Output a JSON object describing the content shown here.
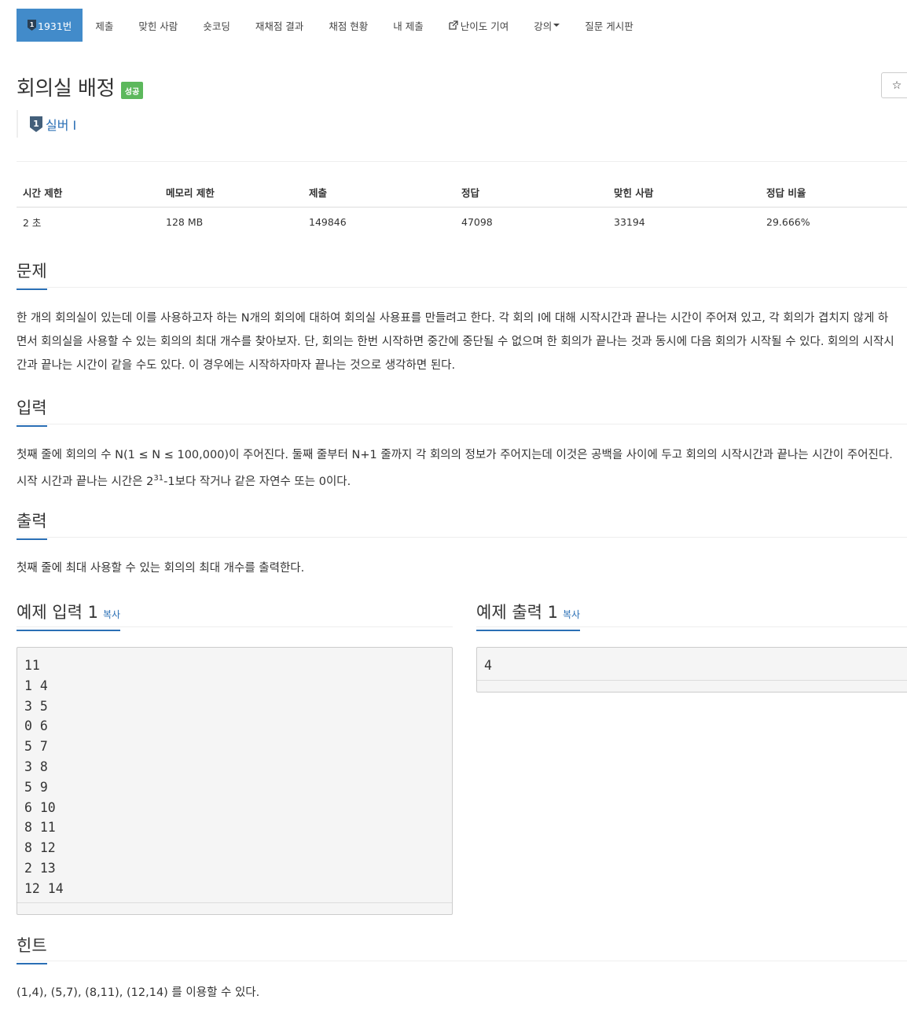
{
  "nav": {
    "problem_number": "1931번",
    "submit": "제출",
    "solvers": "맞힌 사람",
    "short_coding": "숏코딩",
    "rejudge": "재채점 결과",
    "status": "채점 현황",
    "my_submissions": "내 제출",
    "difficulty": "난이도 기여",
    "lecture": "강의",
    "qna": "질문 게시판"
  },
  "problem": {
    "title": "회의실 배정",
    "status_label": "성공",
    "star": "☆",
    "tier": "실버 I"
  },
  "info_table": {
    "headers": [
      "시간 제한",
      "메모리 제한",
      "제출",
      "정답",
      "맞힌 사람",
      "정답 비율"
    ],
    "values": [
      "2 초",
      "128 MB",
      "149846",
      "47098",
      "33194",
      "29.666%"
    ]
  },
  "sections": {
    "description_title": "문제",
    "description_lines": [
      "한 개의 회의실이 있는데 이를 사용하고자 하는 N개의 회의에 대하여 회의실 사용표를 만들려고 한다. 각 회의 I에 대해 시작시간과 끝나는 시간이 주어져 있고, 각 회의가 겹치지 않게 하",
      "면서 회의실을 사용할 수 있는 회의의 최대 개수를 찾아보자. 단, 회의는 한번 시작하면 중간에 중단될 수 없으며 한 회의가 끝나는 것과 동시에 다음 회의가 시작될 수 있다. 회의의 시작시",
      "간과 끝나는 시간이 같을 수도 있다. 이 경우에는 시작하자마자 끝나는 것으로 생각하면 된다."
    ],
    "input_title": "입력",
    "input_line1": "첫째 줄에 회의의 수 N(1 ≤ N ≤ 100,000)이 주어진다. 둘째 줄부터 N+1 줄까지 각 회의의 정보가 주어지는데 이것은 공백을 사이에 두고 회의의 시작시간과 끝나는 시간이 주어진다.",
    "input_line2_pre": "시작 시간과 끝나는 시간은 2",
    "input_line2_sup": "31",
    "input_line2_post": "-1보다 작거나 같은 자연수 또는 0이다.",
    "output_title": "출력",
    "output_text": "첫째 줄에 최대 사용할 수 있는 회의의 최대 개수를 출력한다.",
    "sample_input_title": "예제 입력 1",
    "sample_output_title": "예제 출력 1",
    "copy": "복사",
    "sample_input": "11\n1 4\n3 5\n0 6\n5 7\n3 8\n5 9\n6 10\n8 11\n8 12\n2 13\n12 14",
    "sample_output": "4",
    "hint_title": "힌트",
    "hint_text": "(1,4), (5,7), (8,11), (12,14) 를 이용할 수 있다."
  },
  "colors": {
    "primary": "#428bca",
    "link": "#2a6fb5",
    "success": "#5cb85c",
    "tier_dark": "#435f7a"
  }
}
